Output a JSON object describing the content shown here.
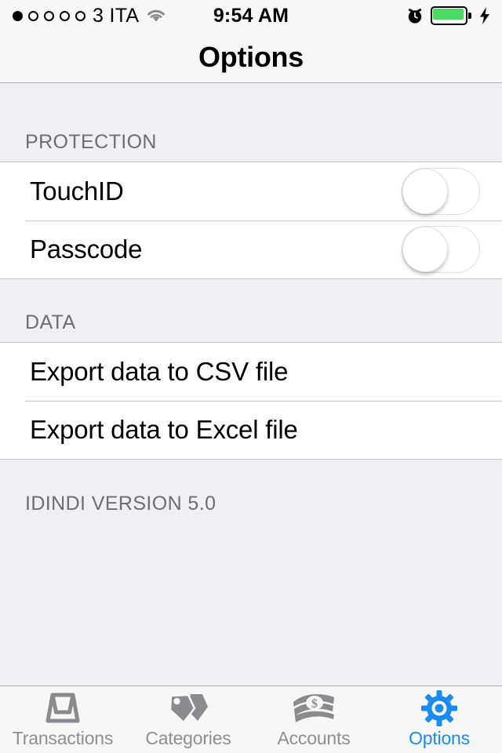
{
  "status_bar": {
    "signal_dots_total": 5,
    "signal_dots_filled": 1,
    "carrier": "3 ITA",
    "wifi_icon": "wifi-icon",
    "time": "9:54 AM",
    "alarm_icon": "alarm-clock-icon",
    "battery_icon": "battery-full-icon",
    "battery_level_percent": 100,
    "battery_color": "#4cd964",
    "charging_icon": "lightning-bolt-icon"
  },
  "nav_bar": {
    "title": "Options"
  },
  "sections": [
    {
      "header": "PROTECTION",
      "rows": [
        {
          "label": "TouchID",
          "type": "switch",
          "value": "off"
        },
        {
          "label": "Passcode",
          "type": "switch",
          "value": "off"
        }
      ]
    },
    {
      "header": "DATA",
      "rows": [
        {
          "label": "Export data to CSV file",
          "type": "action"
        },
        {
          "label": "Export data to Excel file",
          "type": "action"
        }
      ]
    }
  ],
  "footer": {
    "version_text": "IDINDI VERSION 5.0"
  },
  "tab_bar": {
    "active_color": "#1a8cf0",
    "inactive_color": "#8e8e93",
    "tabs": [
      {
        "label": "Transactions",
        "icon": "inbox-tray-icon",
        "active": false
      },
      {
        "label": "Categories",
        "icon": "tags-icon",
        "active": false
      },
      {
        "label": "Accounts",
        "icon": "banknotes-icon",
        "active": false
      },
      {
        "label": "Options",
        "icon": "gear-icon",
        "active": true
      }
    ]
  }
}
